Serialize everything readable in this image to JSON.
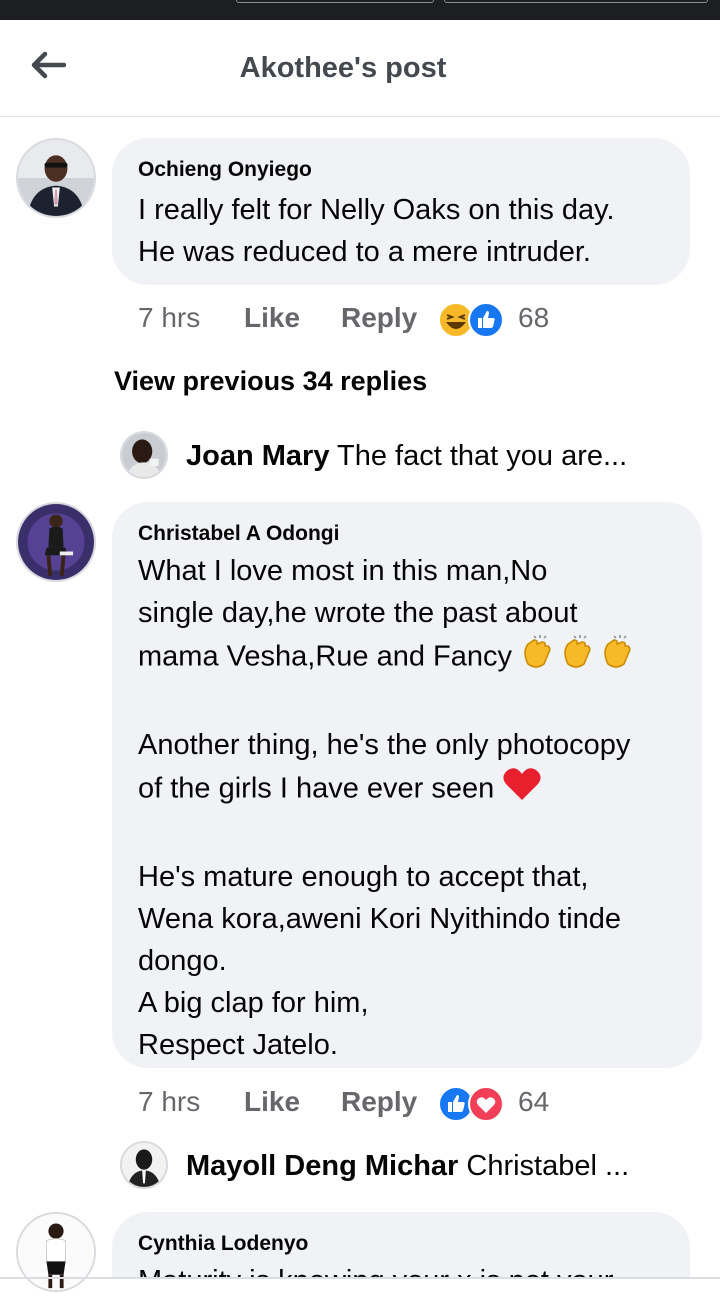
{
  "header": {
    "title": "Akothee's post"
  },
  "comments": [
    {
      "author": "Ochieng Onyiego",
      "lines": [
        "I really felt for Nelly Oaks on this day.",
        "He was reduced to a mere intruder."
      ],
      "time": "7 hrs",
      "like": "Like",
      "reply": "Reply",
      "reaction_count": "68",
      "reactions": [
        "laugh-icon",
        "like-icon"
      ]
    },
    {
      "author": "Christabel A Odongi",
      "lines": [
        "What I love most in this man,No",
        "single day,he wrote the past about",
        "mama Vesha,Rue and Fancy",
        "",
        "Another thing, he's the only photocopy",
        "of the girls I have ever seen",
        "",
        "He's mature enough to accept that,",
        "Wena kora,aweni Kori Nyithindo tinde",
        "dongo.",
        "A big clap for him,",
        "Respect Jatelo."
      ],
      "time": "7 hrs",
      "like": "Like",
      "reply": "Reply",
      "reaction_count": "64",
      "reactions": [
        "like-icon",
        "love-icon"
      ]
    },
    {
      "author": "Cynthia Lodenyo",
      "lines": [
        "Maturity is knowing your x is not your"
      ]
    }
  ],
  "view_previous": "View previous 34 replies",
  "replies": [
    {
      "name": "Joan Mary",
      "text": "The fact that you are..."
    },
    {
      "name": "Mayoll Deng Michar",
      "text": "Christabel ..."
    }
  ],
  "colors": {
    "bubble": "#f0f2f5",
    "meta": "#65676b",
    "like_blue": "#1877f2",
    "love_red": "#f33e58",
    "laugh_yellow": "#f7b928"
  }
}
